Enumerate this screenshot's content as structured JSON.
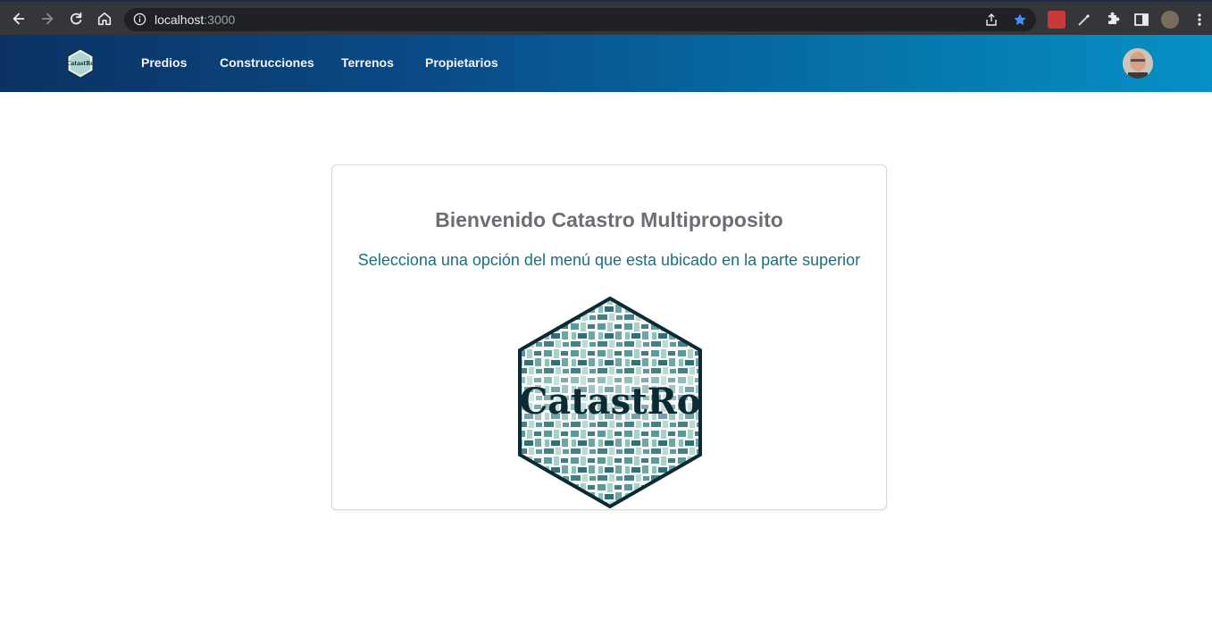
{
  "browser": {
    "url_host": "localhost",
    "url_port": ":3000"
  },
  "nav": {
    "links": [
      {
        "label": "Predios"
      },
      {
        "label": "Construcciones"
      },
      {
        "label": "Terrenos"
      },
      {
        "label": "Propietarios"
      }
    ],
    "brand_logo_text": "CatastRo"
  },
  "main": {
    "title": "Bienvenido Catastro Multiproposito",
    "subtitle": "Selecciona una opción del menú que esta ubicado en la parte superior",
    "logo_text": "CatastRo"
  },
  "colors": {
    "navbar_start": "#0b3263",
    "navbar_end": "#0690c6",
    "title": "#6b6f73",
    "subtitle": "#1d6e80",
    "logo_outline": "#0b2a33"
  }
}
